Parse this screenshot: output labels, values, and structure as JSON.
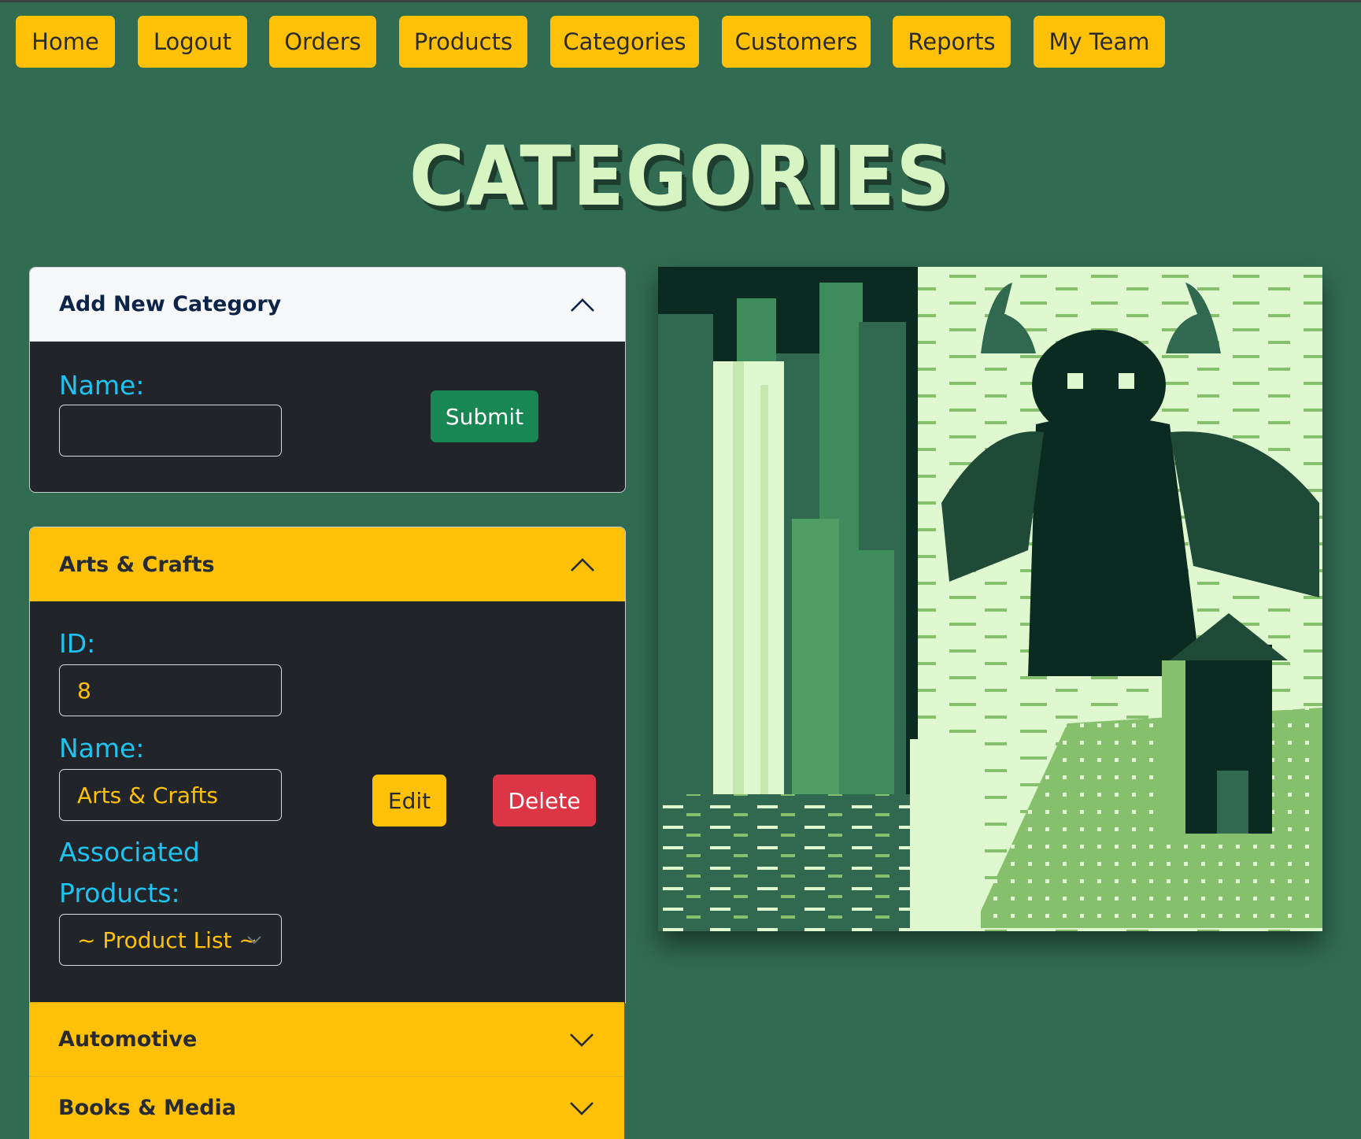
{
  "nav": {
    "items": [
      "Home",
      "Logout",
      "Orders",
      "Products",
      "Categories",
      "Customers",
      "Reports",
      "My Team"
    ]
  },
  "page": {
    "title": "CATEGORIES"
  },
  "add_form": {
    "header": "Add New Category",
    "name_label": "Name:",
    "name_value": "",
    "submit_label": "Submit"
  },
  "category": {
    "header": "Arts & Crafts",
    "id_label": "ID:",
    "id_value": "8",
    "name_label": "Name:",
    "name_value": "Arts & Crafts",
    "products_label_line1": "Associated",
    "products_label_line2": "Products:",
    "products_select": "~ Product List ~",
    "edit_label": "Edit",
    "delete_label": "Delete"
  },
  "accordion": {
    "items": [
      "Automotive",
      "Books & Media"
    ]
  },
  "colors": {
    "background": "#316b52",
    "accent_yellow": "#ffc107",
    "label_cyan": "#1fc3f0",
    "submit_green": "#198754",
    "delete_red": "#dc3545",
    "panel_dark": "#212529"
  },
  "icons": {
    "expanded": "chevron-up-icon",
    "collapsed": "chevron-down-icon",
    "select_caret": "chevron-down-icon"
  }
}
